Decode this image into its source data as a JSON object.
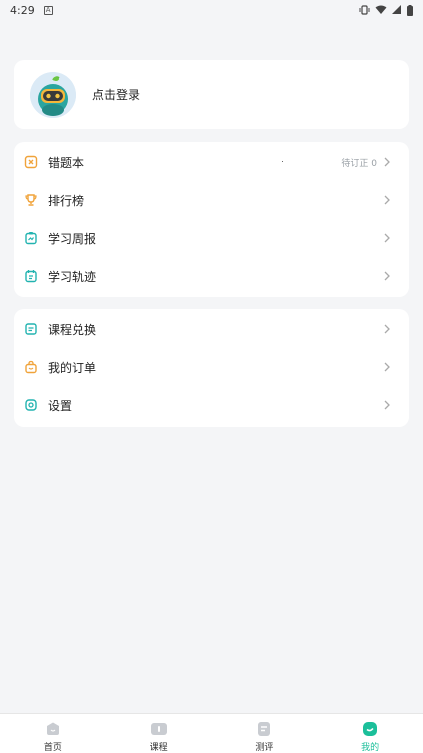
{
  "statusbar": {
    "time": "4:29"
  },
  "profile": {
    "login_text": "点击登录"
  },
  "menu_group_1": [
    {
      "label": "错题本",
      "sub": "待订正 0"
    },
    {
      "label": "排行榜",
      "sub": ""
    },
    {
      "label": "学习周报",
      "sub": ""
    },
    {
      "label": "学习轨迹",
      "sub": ""
    }
  ],
  "menu_group_2": [
    {
      "label": "课程兑换"
    },
    {
      "label": "我的订单"
    },
    {
      "label": "设置"
    }
  ],
  "bottom_nav": [
    {
      "label": "首页",
      "active": false
    },
    {
      "label": "课程",
      "active": false
    },
    {
      "label": "测评",
      "active": false
    },
    {
      "label": "我的",
      "active": true
    }
  ],
  "colors": {
    "accent": "#1bbf9a",
    "orange": "#f0a33a",
    "teal": "#22b3b0",
    "background": "#f4f5f7"
  }
}
